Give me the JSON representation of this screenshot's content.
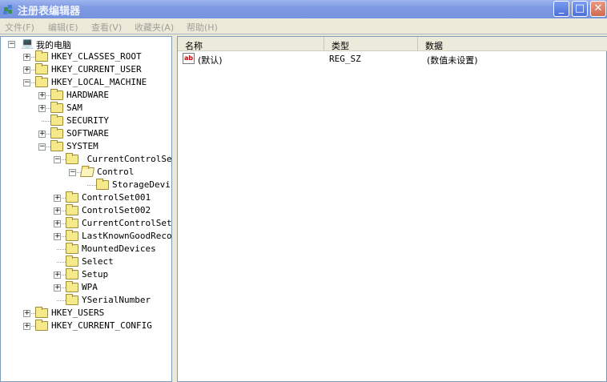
{
  "window": {
    "title": "注册表编辑器",
    "minimize_icon": "minimize-icon",
    "maximize_icon": "maximize-icon",
    "close_icon": "close-icon"
  },
  "menu": [
    {
      "label": "文件(F)"
    },
    {
      "label": "编辑(E)"
    },
    {
      "label": "查看(V)"
    },
    {
      "label": "收藏夹(A)"
    },
    {
      "label": "帮助(H)"
    }
  ],
  "tree": [
    {
      "label": "我的电脑",
      "level": 0,
      "expander": "minus",
      "icon": "computer-icon"
    },
    {
      "label": "HKEY_CLASSES_ROOT",
      "level": 1,
      "expander": "plus",
      "icon": "folder-icon"
    },
    {
      "label": "HKEY_CURRENT_USER",
      "level": 1,
      "expander": "plus",
      "icon": "folder-icon"
    },
    {
      "label": "HKEY_LOCAL_MACHINE",
      "level": 1,
      "expander": "minus",
      "icon": "folder-icon"
    },
    {
      "label": "HARDWARE",
      "level": 2,
      "expander": "plus",
      "icon": "folder-icon"
    },
    {
      "label": "SAM",
      "level": 2,
      "expander": "plus",
      "icon": "folder-icon"
    },
    {
      "label": "SECURITY",
      "level": 2,
      "expander": "none",
      "icon": "folder-icon"
    },
    {
      "label": "SOFTWARE",
      "level": 2,
      "expander": "plus",
      "icon": "folder-icon"
    },
    {
      "label": "SYSTEM",
      "level": 2,
      "expander": "minus",
      "icon": "folder-icon"
    },
    {
      "label": " CurrentControlSet",
      "level": 3,
      "expander": "minus",
      "icon": "folder-icon"
    },
    {
      "label": "Control",
      "level": 4,
      "expander": "minus",
      "icon": "folder-open-icon"
    },
    {
      "label": "StorageDevicePolicies",
      "level": 5,
      "expander": "none",
      "icon": "folder-icon"
    },
    {
      "label": "ControlSet001",
      "level": 3,
      "expander": "plus",
      "icon": "folder-icon"
    },
    {
      "label": "ControlSet002",
      "level": 3,
      "expander": "plus",
      "icon": "folder-icon"
    },
    {
      "label": "CurrentControlSet",
      "level": 3,
      "expander": "plus",
      "icon": "folder-icon"
    },
    {
      "label": "LastKnownGoodRecovery",
      "level": 3,
      "expander": "plus",
      "icon": "folder-icon"
    },
    {
      "label": "MountedDevices",
      "level": 3,
      "expander": "none",
      "icon": "folder-icon"
    },
    {
      "label": "Select",
      "level": 3,
      "expander": "none",
      "icon": "folder-icon"
    },
    {
      "label": "Setup",
      "level": 3,
      "expander": "plus",
      "icon": "folder-icon"
    },
    {
      "label": "WPA",
      "level": 3,
      "expander": "plus",
      "icon": "folder-icon"
    },
    {
      "label": "YSerialNumber",
      "level": 3,
      "expander": "none",
      "icon": "folder-icon"
    },
    {
      "label": "HKEY_USERS",
      "level": 1,
      "expander": "plus",
      "icon": "folder-icon"
    },
    {
      "label": "HKEY_CURRENT_CONFIG",
      "level": 1,
      "expander": "plus",
      "icon": "folder-icon"
    }
  ],
  "list": {
    "columns": [
      "名称",
      "类型",
      "数据"
    ],
    "rows": [
      {
        "name": "(默认)",
        "type": "REG_SZ",
        "data": "(数值未设置)",
        "icon": "string-value-icon"
      }
    ]
  }
}
